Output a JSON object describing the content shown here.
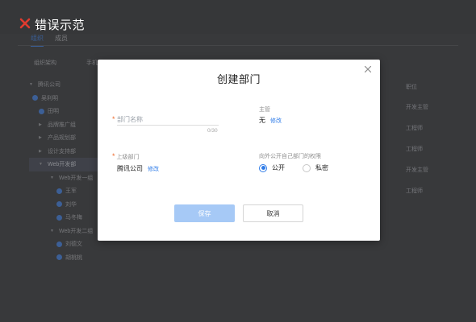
{
  "banner": {
    "icon": "red-x-icon",
    "title": "错误示范",
    "accent_color": "#e03b2f"
  },
  "background": {
    "tabs": [
      "组织",
      "成员"
    ],
    "column_headers": {
      "name": "组织架构",
      "other": "手机",
      "role": "职位"
    },
    "tree_items": [
      {
        "label": "腾讯公司",
        "type": "folder"
      },
      {
        "label": "吴利明",
        "type": "user"
      },
      {
        "label": "田明",
        "type": "user"
      },
      {
        "label": "品牌推广组",
        "type": "folder"
      },
      {
        "label": "产品规划部",
        "type": "folder"
      },
      {
        "label": "设计支持部",
        "type": "folder"
      },
      {
        "label": "Web开发部",
        "type": "folder",
        "selected": true
      },
      {
        "label": "Web开发一组",
        "type": "folder"
      },
      {
        "label": "王军",
        "type": "user"
      },
      {
        "label": "刘华",
        "type": "user"
      },
      {
        "label": "马冬梅",
        "type": "user"
      },
      {
        "label": "Web开发二组",
        "type": "folder"
      },
      {
        "label": "刘德文",
        "type": "user"
      },
      {
        "label": "胡桃桃",
        "type": "user"
      }
    ],
    "role_values": [
      "开发主管",
      "工程师",
      "工程师",
      "开发主管",
      "工程师"
    ]
  },
  "modal": {
    "title": "创建部门",
    "close_icon": "close-icon",
    "name_field": {
      "label": "部门名称",
      "placeholder": "部门名称",
      "value": "",
      "counter": "0/30",
      "required": "*"
    },
    "manager": {
      "label": "主管",
      "value": "无",
      "edit_link": "修改"
    },
    "parent_dept": {
      "label": "上级部门",
      "value": "腾讯公司",
      "edit_link": "修改",
      "required": "*"
    },
    "visibility": {
      "label": "向外公开自己部门的权限",
      "options": [
        {
          "label": "公开",
          "checked": true
        },
        {
          "label": "私密",
          "checked": false
        }
      ]
    },
    "buttons": {
      "save": "保存",
      "cancel": "取消"
    }
  }
}
